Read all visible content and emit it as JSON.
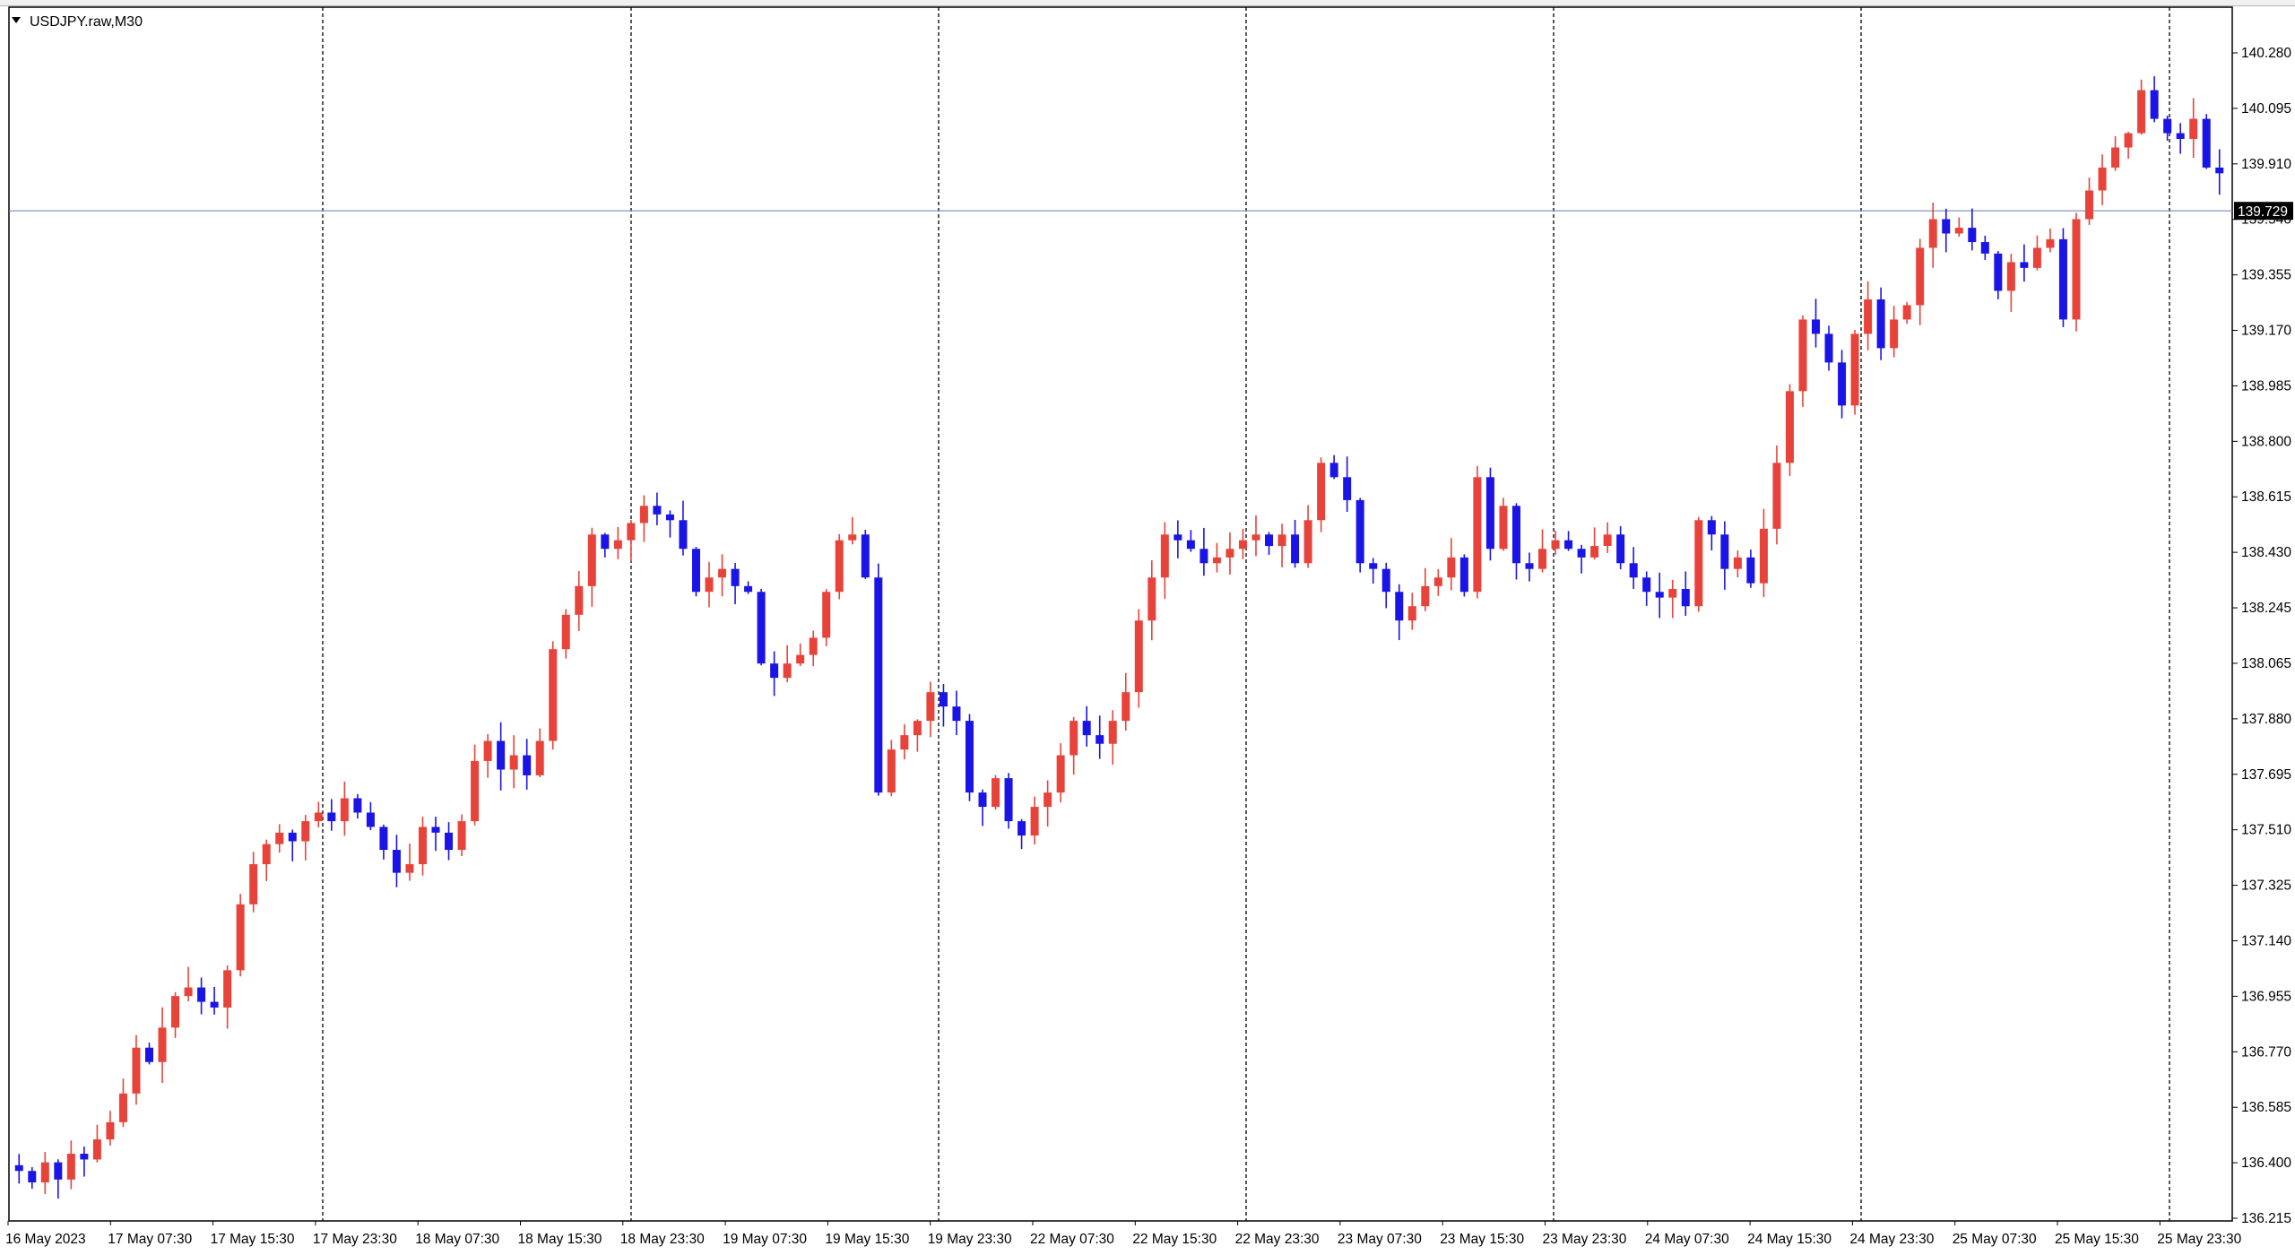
{
  "window": {
    "symbol_title": "USDJPY.raw,M30",
    "collapse_icon": "triangle-down-icon"
  },
  "colors": {
    "background": "#ffffff",
    "frame": "#000000",
    "grid": "#000000",
    "bull": "#e8433a",
    "bear": "#1a14e6",
    "bid_line": "#7a85b8",
    "bid_label_bg": "#000000",
    "bid_label_text": "#ffffff"
  },
  "chart_data": {
    "type": "candlestick",
    "timeframe": "M30",
    "grid": "vertical-dashed",
    "y_ticks": [
      "140.280",
      "140.095",
      "139.910",
      "139.540",
      "139.355",
      "139.170",
      "138.985",
      "138.800",
      "138.615",
      "138.430",
      "138.245",
      "138.065",
      "137.880",
      "137.695",
      "137.510",
      "137.325",
      "137.140",
      "136.955",
      "136.770",
      "136.585",
      "136.400",
      "136.215"
    ],
    "y_range": [
      136.215,
      140.28
    ],
    "x_ticks": [
      "16 May 2023",
      "17 May 07:30",
      "17 May 15:30",
      "17 May 23:30",
      "18 May 07:30",
      "18 May 15:30",
      "18 May 23:30",
      "19 May 07:30",
      "19 May 15:30",
      "19 May 23:30",
      "22 May 07:30",
      "22 May 15:30",
      "22 May 23:30",
      "23 May 07:30",
      "23 May 15:30",
      "23 May 23:30",
      "24 May 07:30",
      "24 May 15:30",
      "24 May 23:30",
      "25 May 07:30",
      "25 May 15:30",
      "25 May 23:30"
    ],
    "bid": "139.729",
    "bid_value": 139.729,
    "candles": [
      136.38,
      136.34,
      136.41,
      136.35,
      136.44,
      136.42,
      136.49,
      136.55,
      136.65,
      136.81,
      136.76,
      136.88,
      136.99,
      137.02,
      136.97,
      136.95,
      137.08,
      137.31,
      137.45,
      137.52,
      137.56,
      137.53,
      137.6,
      137.63,
      137.6,
      137.68,
      137.63,
      137.58,
      137.5,
      137.42,
      137.45,
      137.58,
      137.56,
      137.5,
      137.6,
      137.81,
      137.88,
      137.78,
      137.83,
      137.76,
      137.88,
      138.2,
      138.32,
      138.42,
      138.6,
      138.55,
      138.58,
      138.64,
      138.7,
      138.67,
      138.65,
      138.55,
      138.4,
      138.45,
      138.48,
      138.42,
      138.4,
      138.15,
      138.1,
      138.15,
      138.18,
      138.24,
      138.4,
      138.58,
      138.6,
      138.45,
      137.7,
      137.85,
      137.9,
      137.95,
      138.05,
      138.0,
      137.95,
      137.7,
      137.65,
      137.75,
      137.6,
      137.55,
      137.65,
      137.7,
      137.83,
      137.95,
      137.9,
      137.87,
      137.95,
      138.05,
      138.3,
      138.45,
      138.6,
      138.58,
      138.55,
      138.5,
      138.52,
      138.55,
      138.58,
      138.6,
      138.56,
      138.6,
      138.5,
      138.65,
      138.85,
      138.8,
      138.72,
      138.5,
      138.48,
      138.4,
      138.3,
      138.35,
      138.42,
      138.45,
      138.52,
      138.4,
      138.8,
      138.55,
      138.7,
      138.5,
      138.48,
      138.55,
      138.58,
      138.55,
      138.52,
      138.56,
      138.6,
      138.5,
      138.45,
      138.4,
      138.38,
      138.41,
      138.35,
      138.65,
      138.6,
      138.48,
      138.52,
      138.43,
      138.62,
      138.85,
      139.1,
      139.35,
      139.3,
      139.2,
      139.05,
      139.3,
      139.42,
      139.25,
      139.35,
      139.4,
      139.6,
      139.7,
      139.65,
      139.67,
      139.62,
      139.58,
      139.45,
      139.55,
      139.53,
      139.6,
      139.63,
      139.35,
      139.7,
      139.8,
      139.88,
      139.95,
      140.0,
      140.15,
      140.05,
      140.0,
      139.98,
      140.05,
      139.88,
      139.86
    ],
    "start_open": 136.4,
    "wick_seed": 7
  }
}
